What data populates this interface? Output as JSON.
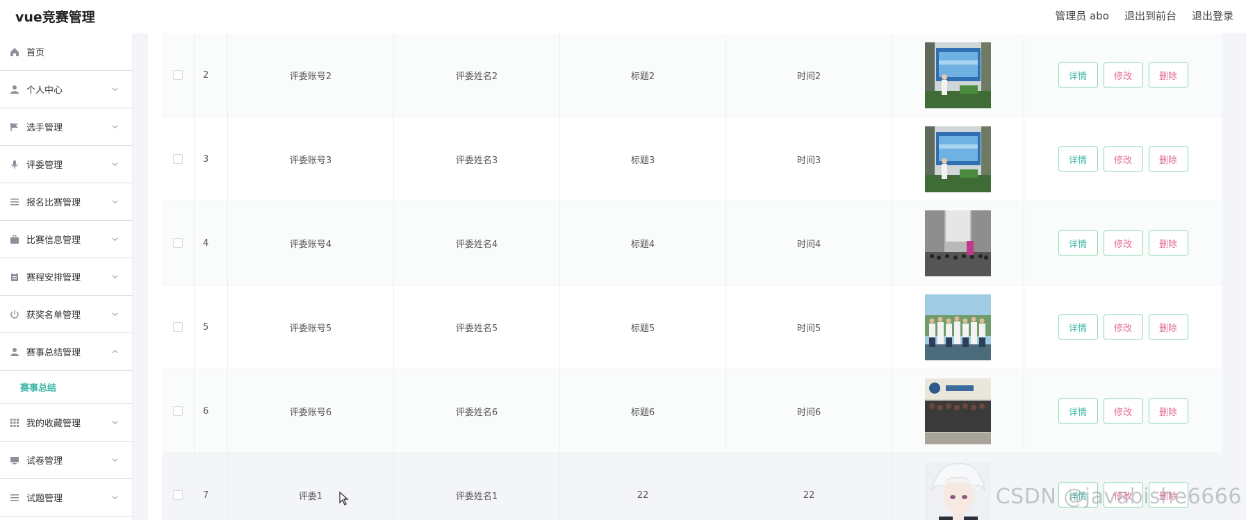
{
  "app": {
    "title": "vue竞赛管理"
  },
  "header": {
    "user_label": "管理员 abo",
    "to_front": "退出到前台",
    "logout": "退出登录"
  },
  "sidebar": {
    "items": [
      {
        "label": "首页",
        "icon": "home-icon",
        "chevron": false
      },
      {
        "label": "个人中心",
        "icon": "user-icon",
        "chevron": true
      },
      {
        "label": "选手管理",
        "icon": "flag-icon",
        "chevron": true
      },
      {
        "label": "评委管理",
        "icon": "mic-icon",
        "chevron": true
      },
      {
        "label": "报名比赛管理",
        "icon": "list-icon",
        "chevron": true
      },
      {
        "label": "比赛信息管理",
        "icon": "briefcase-icon",
        "chevron": true
      },
      {
        "label": "赛程安排管理",
        "icon": "clipboard-icon",
        "chevron": true
      },
      {
        "label": "获奖名单管理",
        "icon": "power-icon",
        "chevron": true
      },
      {
        "label": "赛事总结管理",
        "icon": "user-icon",
        "chevron": "up"
      },
      {
        "label": "我的收藏管理",
        "icon": "grid-icon",
        "chevron": true
      },
      {
        "label": "试卷管理",
        "icon": "monitor-icon",
        "chevron": true
      },
      {
        "label": "试题管理",
        "icon": "list-icon",
        "chevron": true
      }
    ],
    "active_submenu": "赛事总结"
  },
  "table": {
    "rows": [
      {
        "index": "2",
        "account": "评委账号2",
        "name": "评委姓名2",
        "title": "标题2",
        "time": "时间2",
        "image": "photo-poster"
      },
      {
        "index": "3",
        "account": "评委账号3",
        "name": "评委姓名3",
        "title": "标题3",
        "time": "时间3",
        "image": "photo-poster"
      },
      {
        "index": "4",
        "account": "评委账号4",
        "name": "评委姓名4",
        "title": "标题4",
        "time": "时间4",
        "image": "photo-hall"
      },
      {
        "index": "5",
        "account": "评委账号5",
        "name": "评委姓名5",
        "title": "标题5",
        "time": "时间5",
        "image": "photo-group-outdoor"
      },
      {
        "index": "6",
        "account": "评委账号6",
        "name": "评委姓名6",
        "title": "标题6",
        "time": "时间6",
        "image": "photo-group-indoor"
      },
      {
        "index": "7",
        "account": "评委1",
        "name": "评委姓名1",
        "title": "22",
        "time": "22",
        "image": "photo-avatar"
      }
    ],
    "actions": {
      "detail": "详情",
      "edit": "修改",
      "delete": "删除"
    }
  },
  "watermark": "CSDN @javabishe6666",
  "colors": {
    "accent": "#3fb6a8",
    "danger": "#e36a9a",
    "button_border": "#86d8a8"
  }
}
